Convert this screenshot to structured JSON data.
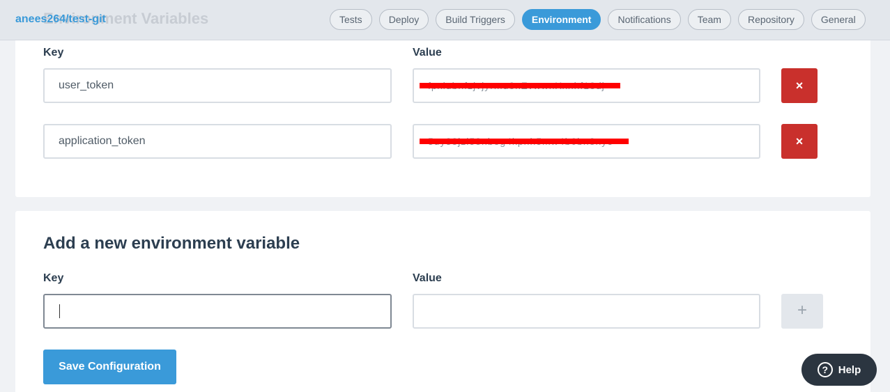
{
  "header": {
    "repo_name": "anees264/test-git",
    "background_heading": "Environment Variables",
    "tabs": [
      {
        "label": "Tests"
      },
      {
        "label": "Deploy"
      },
      {
        "label": "Build Triggers"
      },
      {
        "label": "Environment",
        "active": true
      },
      {
        "label": "Notifications"
      },
      {
        "label": "Team"
      },
      {
        "label": "Repository"
      },
      {
        "label": "General"
      }
    ]
  },
  "env_vars": {
    "key_label": "Key",
    "value_label": "Value",
    "rows": [
      {
        "key": "user_token",
        "value_redacted": "fpxlubnfzjvjyrmu8nZvwwnXxnhf18dj"
      },
      {
        "key": "application_token",
        "value_redacted": "5uy38jzi58nbeg4kpnh5mw4b0bn8nyo"
      }
    ],
    "delete_icon": "×"
  },
  "new_var": {
    "title": "Add a new environment variable",
    "key_label": "Key",
    "value_label": "Value",
    "key_value": "",
    "value_value": "",
    "add_icon": "+"
  },
  "actions": {
    "save_label": "Save Configuration",
    "help_label": "Help",
    "help_icon": "?"
  },
  "colors": {
    "accent": "#3a9ad9",
    "danger": "#c9302c",
    "redaction": "#ff0000",
    "help_bg": "#2b3540"
  }
}
